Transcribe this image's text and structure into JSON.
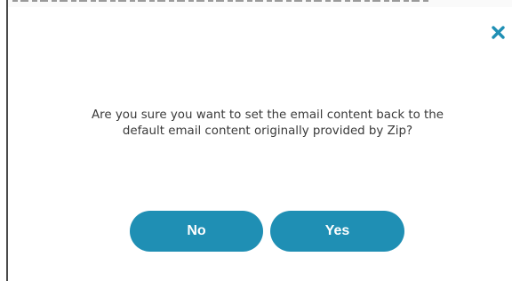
{
  "dialog": {
    "message_line1": "Are you sure you want to set the email content back to the",
    "message_line2": "default email content originally provided by Zip?",
    "no_label": "No",
    "yes_label": "Yes",
    "close_icon": "close-icon"
  },
  "colors": {
    "accent": "#1f8fb4",
    "close_icon": "#1f8fb4",
    "message_text": "#3a3a3a",
    "button_text": "#ffffff",
    "background": "#ffffff"
  }
}
